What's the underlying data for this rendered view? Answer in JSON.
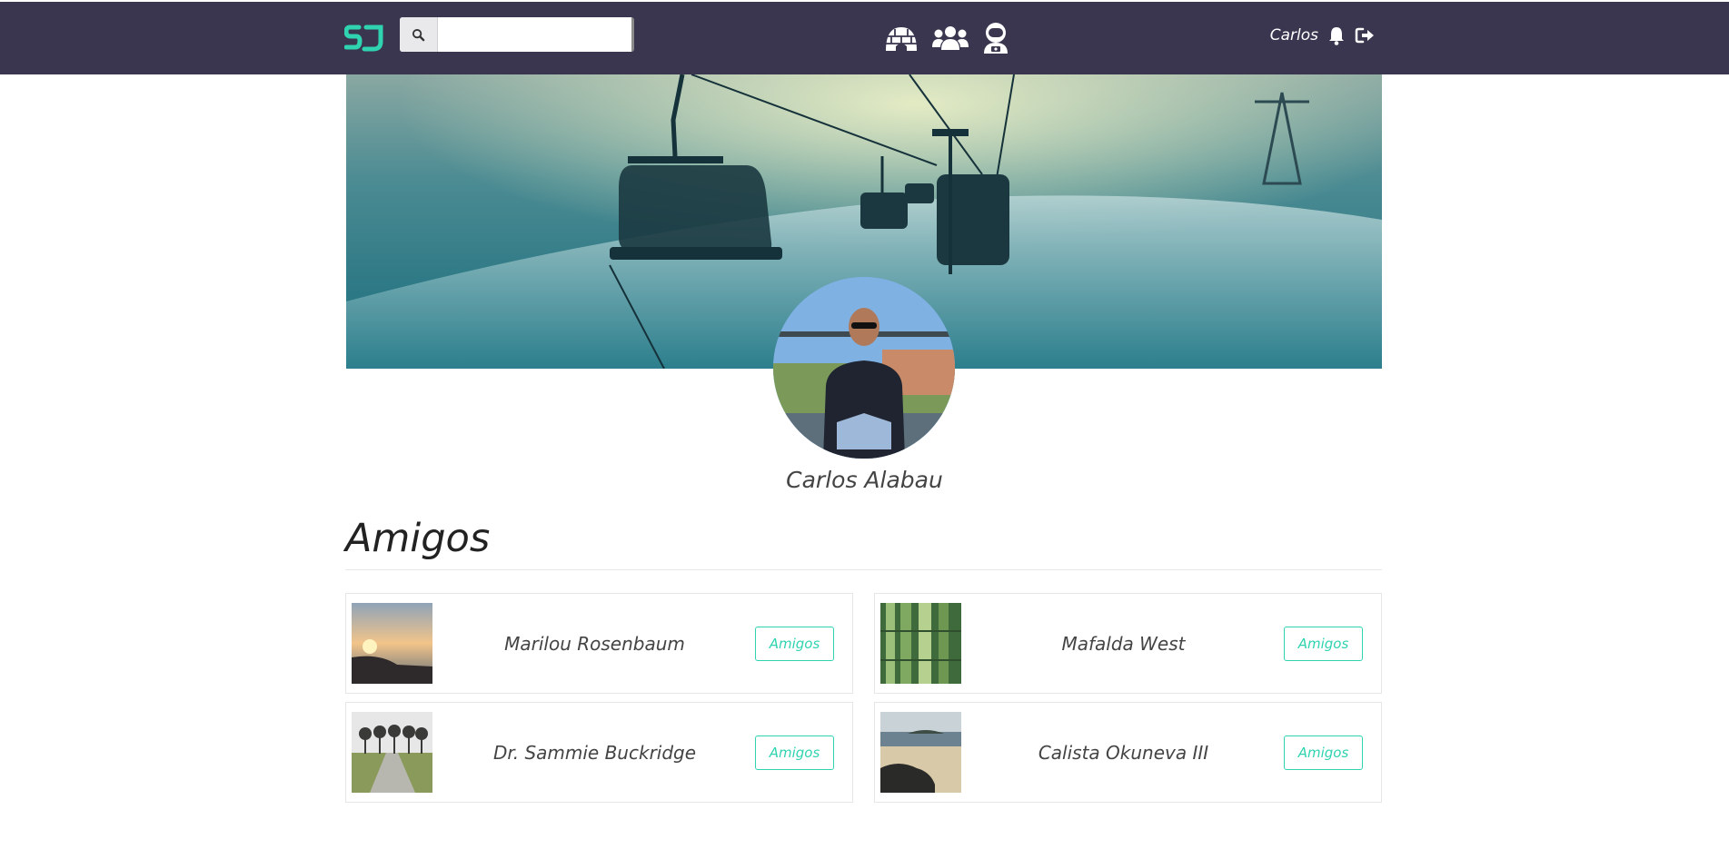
{
  "app": {
    "brand_color": "#3a3650",
    "accent_color": "#2fd3b0",
    "logo_icon": "sj-logo-icon"
  },
  "header": {
    "search": {
      "placeholder": "",
      "value": "",
      "icon": "search-icon"
    },
    "nav_icons": [
      "igloo-icon",
      "users-icon",
      "user-astronaut-icon"
    ],
    "username": "Carlos",
    "notification_icon": "bell-icon",
    "logout_icon": "sign-out-icon"
  },
  "profile": {
    "cover_image": "ski-lift-cover-image",
    "avatar_image": "profile-avatar-photo",
    "name": "Carlos Alabau"
  },
  "friends_section": {
    "title": "Amigos",
    "friends": [
      {
        "name": "Marilou Rosenbaum",
        "button": "Amigos",
        "thumb": "sunset-coast-thumb"
      },
      {
        "name": "Mafalda West",
        "button": "Amigos",
        "thumb": "bamboo-thumb"
      },
      {
        "name": "Dr. Sammie Buckridge",
        "button": "Amigos",
        "thumb": "tree-path-thumb"
      },
      {
        "name": "Calista Okuneva III",
        "button": "Amigos",
        "thumb": "beach-rocks-thumb"
      }
    ]
  }
}
